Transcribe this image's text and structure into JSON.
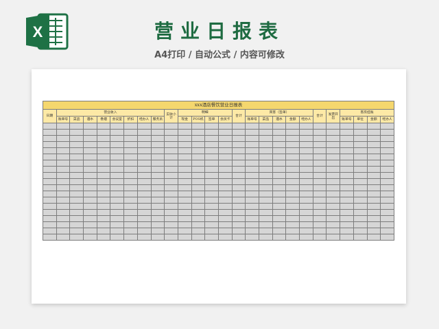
{
  "header": {
    "title": "营业日报表",
    "subtitle": "A4打印 / 自动公式 / 内容可修改"
  },
  "logo": {
    "icon": "excel-icon",
    "letter": "X",
    "color": "#1e7145"
  },
  "table": {
    "title": "xxx酒店餐饮营业日报表",
    "date_label": "日期",
    "groups": [
      {
        "label": "营业收入",
        "span": 8
      },
      {
        "label": "实收小计",
        "span": 1
      },
      {
        "label": "明细",
        "span": 4
      },
      {
        "label": "合计",
        "span": 1
      },
      {
        "label": "宾客（签单）",
        "span": 5
      },
      {
        "label": "合计",
        "span": 1
      },
      {
        "label": "发票开出",
        "span": 1
      },
      {
        "label": "客房挂账",
        "span": 4
      }
    ],
    "subheaders": [
      "账单号",
      "菜品",
      "酒水",
      "香烟",
      "会议室",
      "折扣",
      "经办人",
      "服务员",
      "现金",
      "POS机",
      "签单",
      "会员卡",
      "账单号",
      "菜品",
      "酒水",
      "金额",
      "经办人",
      "账单号",
      "单位",
      "金额",
      "经办人"
    ],
    "row_count": 19,
    "colors": {
      "title_bg": "#f5d76e",
      "header_bg": "#fde9a6",
      "cell_bg": "#d6d6d6"
    }
  }
}
